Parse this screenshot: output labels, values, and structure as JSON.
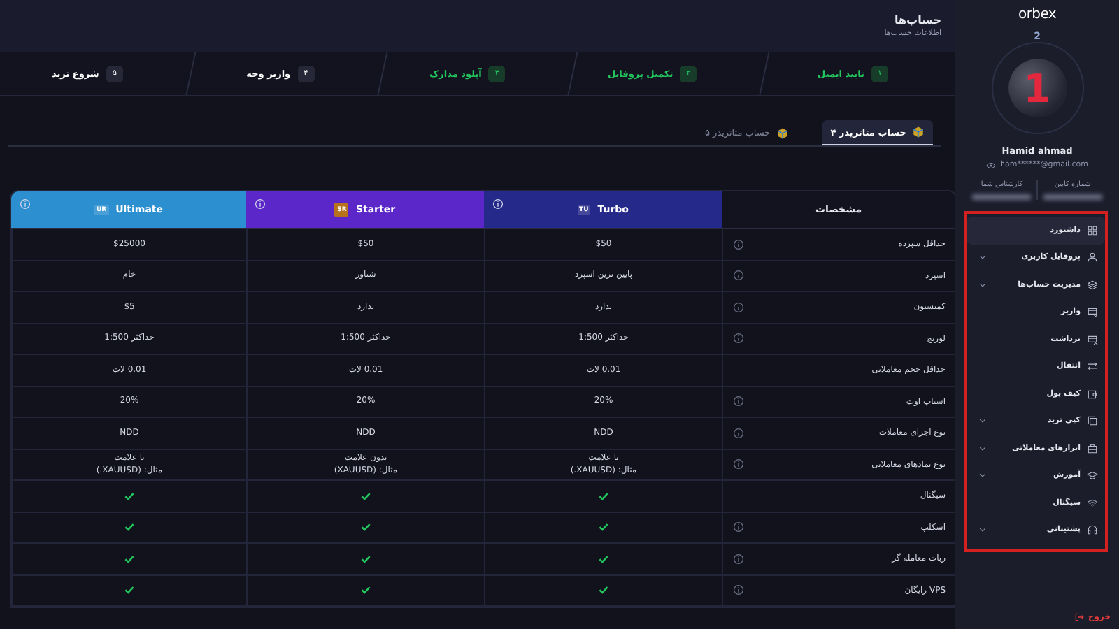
{
  "header": {
    "title": "حساب‌ها",
    "subtitle": "اطلاعات حساب‌ها"
  },
  "steps": [
    {
      "number": "۱",
      "label": "تایید ایمیل",
      "done": true
    },
    {
      "number": "۲",
      "label": "تکمیل پروفایل",
      "done": true
    },
    {
      "number": "۳",
      "label": "آپلود مدارک",
      "done": true
    },
    {
      "number": "۴",
      "label": "واریز وجه",
      "done": false
    },
    {
      "number": "۵",
      "label": "شروع ترید",
      "done": false
    }
  ],
  "tabs": [
    {
      "label": "حساب متاتریدر ۴",
      "selected": true
    },
    {
      "label": "حساب متاتریدر ۵",
      "selected": false
    }
  ],
  "table": {
    "spec_heading": "مشخصات",
    "plans": [
      {
        "name": "Turbo",
        "badge": "TU",
        "color": "#25298a"
      },
      {
        "name": "Starter",
        "badge": "SR",
        "color": "#5b27c9"
      },
      {
        "name": "Ultimate",
        "badge": "UR",
        "color": "#2c8fd0"
      }
    ],
    "rows": [
      {
        "label": "حداقل سپرده",
        "info": true,
        "cells": [
          {
            "kind": "text",
            "text": "$50"
          },
          {
            "kind": "text",
            "text": "$50"
          },
          {
            "kind": "text",
            "text": "$25000"
          }
        ]
      },
      {
        "label": "اسپرد",
        "info": true,
        "cells": [
          {
            "kind": "text",
            "text": "پایین ترین اسپرد"
          },
          {
            "kind": "text",
            "text": "شناور"
          },
          {
            "kind": "text",
            "text": "خام"
          }
        ]
      },
      {
        "label": "کمیسیون",
        "info": true,
        "cells": [
          {
            "kind": "text",
            "text": "ندارد"
          },
          {
            "kind": "text",
            "text": "ندارد"
          },
          {
            "kind": "text",
            "text": "$5"
          }
        ]
      },
      {
        "label": "لوریج",
        "info": true,
        "cells": [
          {
            "kind": "text",
            "text": "حداکثر 1:500"
          },
          {
            "kind": "text",
            "text": "حداکثر 1:500"
          },
          {
            "kind": "text",
            "text": "حداکثر 1:500"
          }
        ]
      },
      {
        "label": "حداقل حجم معاملاتی",
        "info": false,
        "cells": [
          {
            "kind": "text",
            "text": "0.01 لات"
          },
          {
            "kind": "text",
            "text": "0.01 لات"
          },
          {
            "kind": "text",
            "text": "0.01 لات"
          }
        ]
      },
      {
        "label": "استاپ اوت",
        "info": true,
        "cells": [
          {
            "kind": "text",
            "text": "20%"
          },
          {
            "kind": "text",
            "text": "20%"
          },
          {
            "kind": "text",
            "text": "20%"
          }
        ]
      },
      {
        "label": "نوع اجرای معاملات",
        "info": true,
        "cells": [
          {
            "kind": "text",
            "text": "NDD"
          },
          {
            "kind": "text",
            "text": "NDD"
          },
          {
            "kind": "text",
            "text": "NDD"
          }
        ]
      },
      {
        "label": "نوع نمادهای معاملاتی",
        "info": true,
        "cells": [
          {
            "kind": "text",
            "text": "با علامت\nمثال: (XAUUSD.)"
          },
          {
            "kind": "text",
            "text": "بدون علامت\nمثال: (XAUUSD)"
          },
          {
            "kind": "text",
            "text": "با علامت\nمثال: (XAUUSD.)"
          }
        ]
      },
      {
        "label": "سیگنال",
        "info": false,
        "cells": [
          {
            "kind": "check"
          },
          {
            "kind": "check"
          },
          {
            "kind": "check"
          }
        ]
      },
      {
        "label": "اسکلپ",
        "info": true,
        "cells": [
          {
            "kind": "check"
          },
          {
            "kind": "check"
          },
          {
            "kind": "check"
          }
        ]
      },
      {
        "label": "ربات معامله گر",
        "info": true,
        "cells": [
          {
            "kind": "check"
          },
          {
            "kind": "check"
          },
          {
            "kind": "check"
          }
        ]
      },
      {
        "label": "VPS رایگان",
        "info": true,
        "cells": [
          {
            "kind": "check"
          },
          {
            "kind": "check"
          },
          {
            "kind": "check"
          }
        ]
      }
    ]
  },
  "sidebar": {
    "logo": "orbex",
    "next_level": "2",
    "level": "1",
    "name": "Hamid ahmad",
    "email": "ham******@gmail.com",
    "fields": [
      {
        "label": "شماره کابین"
      },
      {
        "label": "کارشناس شما"
      }
    ],
    "menu": [
      {
        "label": "داشبورد",
        "selected": true,
        "expandable": false
      },
      {
        "label": "پروفایل کاربری",
        "selected": false,
        "expandable": true
      },
      {
        "label": "مدیریت حساب‌ها",
        "selected": false,
        "expandable": true
      },
      {
        "label": "واریز",
        "selected": false,
        "expandable": false
      },
      {
        "label": "برداشت",
        "selected": false,
        "expandable": false
      },
      {
        "label": "انتقال",
        "selected": false,
        "expandable": false
      },
      {
        "label": "کیف پول",
        "selected": false,
        "expandable": false
      },
      {
        "label": "کپی ترید",
        "selected": false,
        "expandable": true
      },
      {
        "label": "ابزارهای معاملاتی",
        "selected": false,
        "expandable": true
      },
      {
        "label": "آموزش",
        "selected": false,
        "expandable": true
      },
      {
        "label": "سیگنال",
        "selected": false,
        "expandable": false
      },
      {
        "label": "پشتیبانی",
        "selected": false,
        "expandable": true
      }
    ],
    "logout": "خروج"
  }
}
